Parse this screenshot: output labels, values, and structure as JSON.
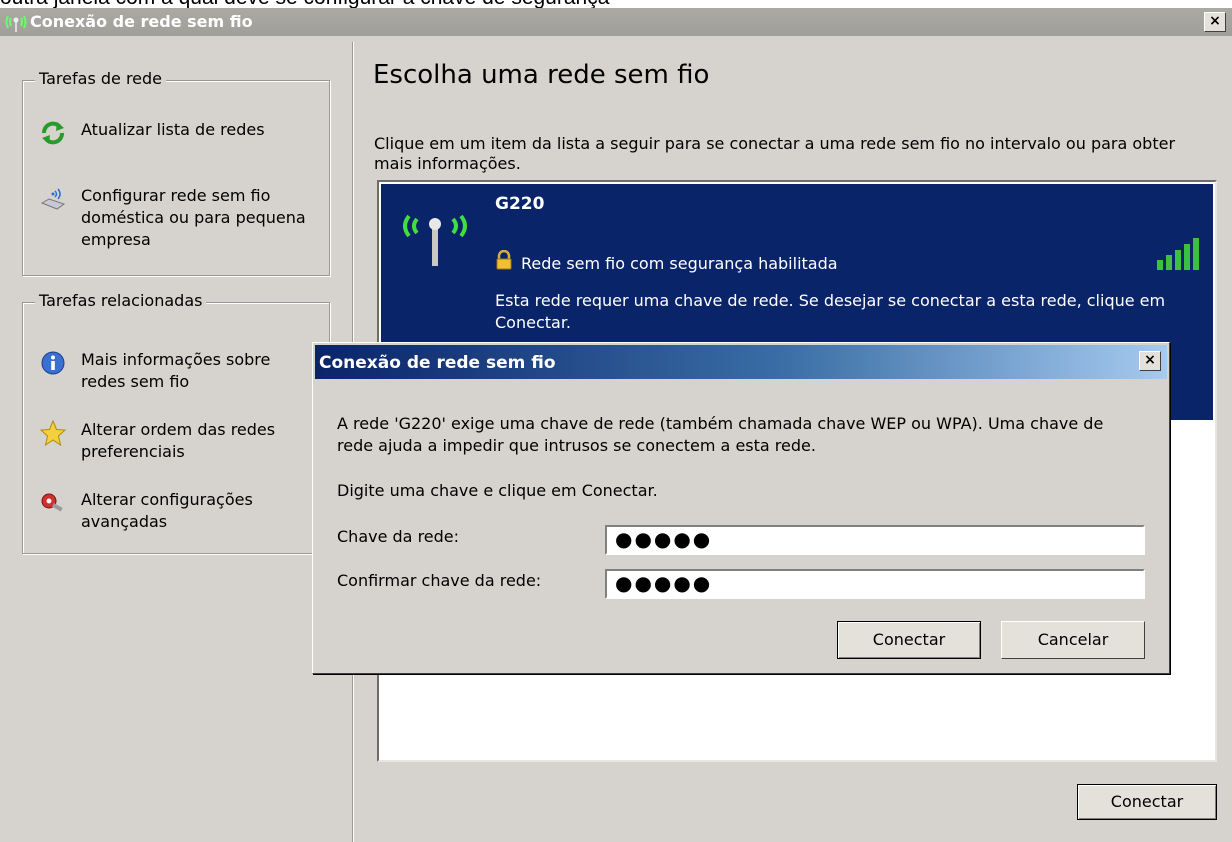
{
  "cropped_text": "outra janela com a qual  deve se configurar a chave de segurança",
  "window": {
    "title": "Conexão de rede sem fio",
    "close_glyph": "×"
  },
  "left_pane": {
    "network_tasks": {
      "title": "Tarefas de rede",
      "items": [
        {
          "label": "Atualizar lista de redes",
          "icon": "refresh-icon"
        },
        {
          "label": "Configurar rede sem fio doméstica ou para pequena empresa",
          "icon": "wireless-setup-icon"
        }
      ]
    },
    "related_tasks": {
      "title": "Tarefas relacionadas",
      "items": [
        {
          "label": "Mais informações sobre redes sem fio",
          "icon": "info-icon"
        },
        {
          "label": "Alterar ordem das redes preferenciais",
          "icon": "star-icon"
        },
        {
          "label": "Alterar configurações avançadas",
          "icon": "settings-icon"
        }
      ]
    }
  },
  "content": {
    "title": "Escolha uma rede sem fio",
    "description": "Clique em um item da lista a seguir para se conectar a uma rede sem fio no intervalo ou para obter mais informações.",
    "network": {
      "name": "G220",
      "security": "Rede sem fio com segurança habilitada",
      "description": "Esta rede requer uma chave de rede. Se desejar se conectar a esta rede, clique em Conectar.",
      "signal_bars": 5
    },
    "connect_label": "Conectar"
  },
  "dialog": {
    "title": "Conexão de rede sem fio",
    "close_glyph": "×",
    "message": "A rede 'G220' exige uma chave de rede (também chamada chave WEP ou WPA). Uma chave de rede ajuda a impedir que intrusos se conectem a esta rede.",
    "instruction": "Digite uma chave e clique em Conectar.",
    "key_label": "Chave da rede:",
    "key_value": "●●●●●",
    "confirm_label": "Confirmar chave da rede:",
    "confirm_value": "●●●●●",
    "connect_label": "Conectar",
    "cancel_label": "Cancelar"
  },
  "colors": {
    "selection": "#0a246a",
    "window_bg": "#d6d3ce",
    "signal": "#3fbf3f"
  }
}
